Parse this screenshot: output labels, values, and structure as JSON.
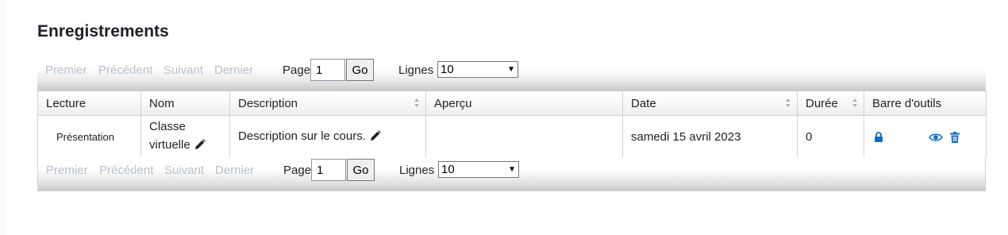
{
  "page": {
    "title": "Enregistrements"
  },
  "pager": {
    "first": "Premier",
    "previous": "Précédent",
    "next": "Suivant",
    "last": "Dernier",
    "page_label": "Page",
    "page_value": "1",
    "go": "Go",
    "rows_label": "Lignes",
    "rows_value": "10"
  },
  "table": {
    "headers": {
      "lecture": "Lecture",
      "nom": "Nom",
      "description": "Description",
      "apercu": "Aperçu",
      "date": "Date",
      "duree": "Durée",
      "barre": "Barre d'outils"
    },
    "rows": [
      {
        "lecture": "Présentation",
        "nom_line1": "Classe",
        "nom_line2": "virtuelle",
        "description": "Description sur le cours.",
        "apercu": "",
        "date": "samedi 15 avril 2023",
        "duree": "0",
        "tools": [
          "lock-icon",
          "eye-icon",
          "trash-icon"
        ]
      }
    ]
  },
  "colors": {
    "accent": "#0f6cbf",
    "disabled_link": "#b6bfc9"
  }
}
